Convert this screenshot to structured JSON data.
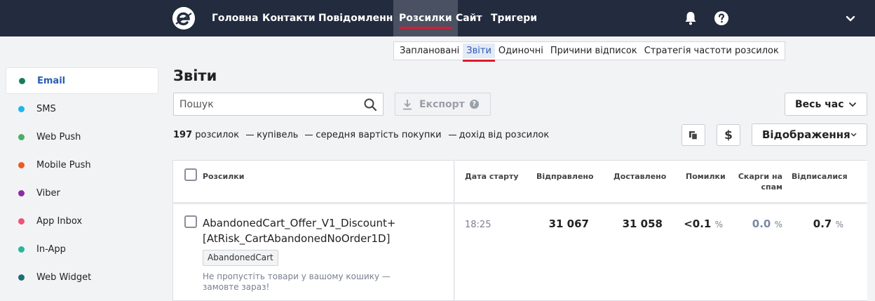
{
  "nav": {
    "items": [
      {
        "label": "Головна"
      },
      {
        "label": "Контакти"
      },
      {
        "label": "Повідомлення"
      },
      {
        "label": "Розсилки",
        "active": true
      },
      {
        "label": "Сайт"
      },
      {
        "label": "Тригери"
      }
    ],
    "icons": [
      "logo-icon",
      "bell-icon",
      "help-icon",
      "chevron-down-icon"
    ]
  },
  "subtabs": [
    {
      "label": "Заплановані"
    },
    {
      "label": "Звіти",
      "active": true
    },
    {
      "label": "Одиночні"
    },
    {
      "label": "Причини відписок"
    },
    {
      "label": "Стратегія частоти розсилок"
    }
  ],
  "sidebar": {
    "items": [
      {
        "label": "Email",
        "color": "#1b7a5a",
        "active": true
      },
      {
        "label": "SMS",
        "color": "#1fb6e8"
      },
      {
        "label": "Web Push",
        "color": "#4cae6a"
      },
      {
        "label": "Mobile Push",
        "color": "#ef5a24"
      },
      {
        "label": "Viber",
        "color": "#8e2aa8"
      },
      {
        "label": "App Inbox",
        "color": "#f0527a"
      },
      {
        "label": "In-App",
        "color": "#2ab59a"
      },
      {
        "label": "Web Widget",
        "color": "#1e6e78"
      }
    ]
  },
  "page": {
    "title": "Звіти",
    "search_placeholder": "Пошук",
    "export_label": "Експорт",
    "period_label": "Весь час",
    "view_label": "Відображення"
  },
  "stats": {
    "count": "197",
    "count_label": "розсилок",
    "purchases_label": "купівель",
    "avg_label": "середня вартість покупки",
    "revenue_label": "дохід від розсилок"
  },
  "table": {
    "headers": {
      "name": "Розсилки",
      "start": "Дата старту",
      "sent": "Відправлено",
      "delivered": "Доставлено",
      "errors": "Помилки",
      "spam": "Скарги на спам",
      "unsub": "Відписалися"
    },
    "rows": [
      {
        "name": "AbandonedCart_Offer_V1_Discount+ [AtRisk_CartAbandonedNoOrder1D]",
        "tag": "AbandonedCart",
        "description": "Не пропустіть товари у вашому кошику — замовте зараз!",
        "start": "18:25",
        "sent": "31 067",
        "delivered": "31 058",
        "errors": "<0.1",
        "spam": "0.0",
        "unsub": "0.7",
        "pct": "%"
      }
    ]
  },
  "colors": {
    "topbar": "#232b3e",
    "accent_red": "#e3182d",
    "link_blue": "#2b5bb5"
  }
}
